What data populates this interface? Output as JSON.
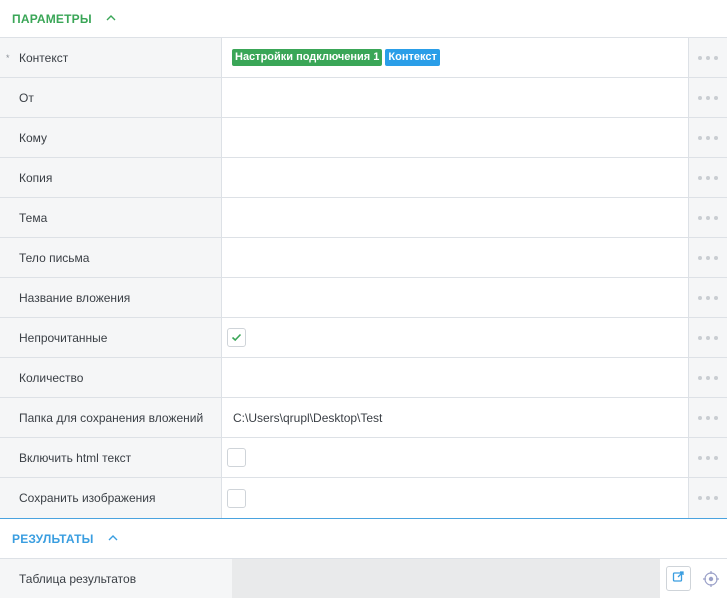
{
  "parameters": {
    "title": "ПАРАМЕТРЫ",
    "rows": [
      {
        "label": "Контекст",
        "required_mark": "*",
        "tags": [
          "Настройки подключения 1",
          "Контекст"
        ]
      },
      {
        "label": "От",
        "value": ""
      },
      {
        "label": "Кому",
        "value": ""
      },
      {
        "label": "Копия",
        "value": ""
      },
      {
        "label": "Тема",
        "value": ""
      },
      {
        "label": "Тело письма",
        "value": ""
      },
      {
        "label": "Название вложения",
        "value": ""
      },
      {
        "label": "Непрочитанные",
        "checked": true
      },
      {
        "label": "Количество",
        "value": ""
      },
      {
        "label": "Папка для сохранения вложений",
        "value": "C:\\Users\\qrupl\\Desktop\\Test"
      },
      {
        "label": "Включить html текст",
        "checked": false
      },
      {
        "label": "Сохранить изображения",
        "checked": false
      }
    ]
  },
  "results": {
    "title": "РЕЗУЛЬТАТЫ",
    "rows": [
      {
        "label": "Таблица результатов",
        "value": ""
      }
    ]
  },
  "colors": {
    "params_accent": "#3aa657",
    "results_accent": "#3a9ee0",
    "tag_green": "#3aa657",
    "tag_blue": "#2a9ee8"
  },
  "icons": {
    "collapse": "chevron-up-icon",
    "more": "more-dots-icon",
    "check": "checkmark-icon",
    "open": "open-external-icon",
    "locate": "crosshair-target-icon"
  }
}
